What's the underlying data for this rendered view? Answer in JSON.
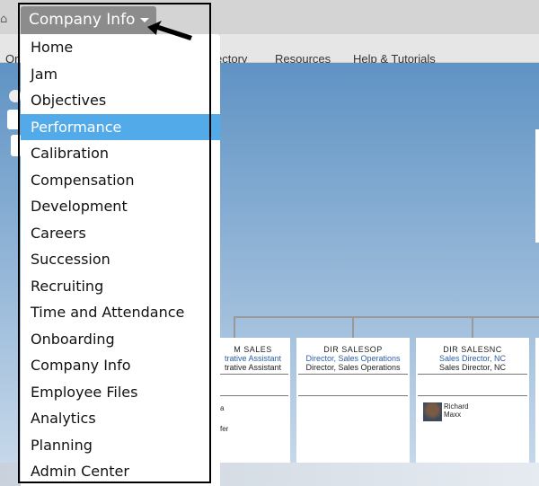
{
  "header": {
    "home_icon": "home-icon",
    "dropdown_label": "Company Info"
  },
  "nav": {
    "items": [
      "Or",
      "ectory",
      "Resources",
      "Help & Tutorials"
    ]
  },
  "menu": {
    "items": [
      "Home",
      "Jam",
      "Objectives",
      "Performance",
      "Calibration",
      "Compensation",
      "Development",
      "Careers",
      "Succession",
      "Recruiting",
      "Time and Attendance",
      "Onboarding",
      "Company Info",
      "Employee Files",
      "Analytics",
      "Planning",
      "Admin Center"
    ],
    "selected": "Performance",
    "highlight_color": "#53aae8"
  },
  "org": {
    "cards": [
      {
        "code": "M  SALES",
        "title1": "trative Assistant",
        "title2": "trative Assistant",
        "person_first": "a",
        "person_last": "",
        "extra": "fer"
      },
      {
        "code": "DIR  SALESOP",
        "title1": "Director, Sales Operations",
        "title2": "Director, Sales Operations"
      },
      {
        "code": "DIR  SALESNC",
        "title1": "Sales Director, NC",
        "title2": "Sales Director, NC",
        "person_first": "Richard",
        "person_last": "Maxx"
      }
    ]
  }
}
